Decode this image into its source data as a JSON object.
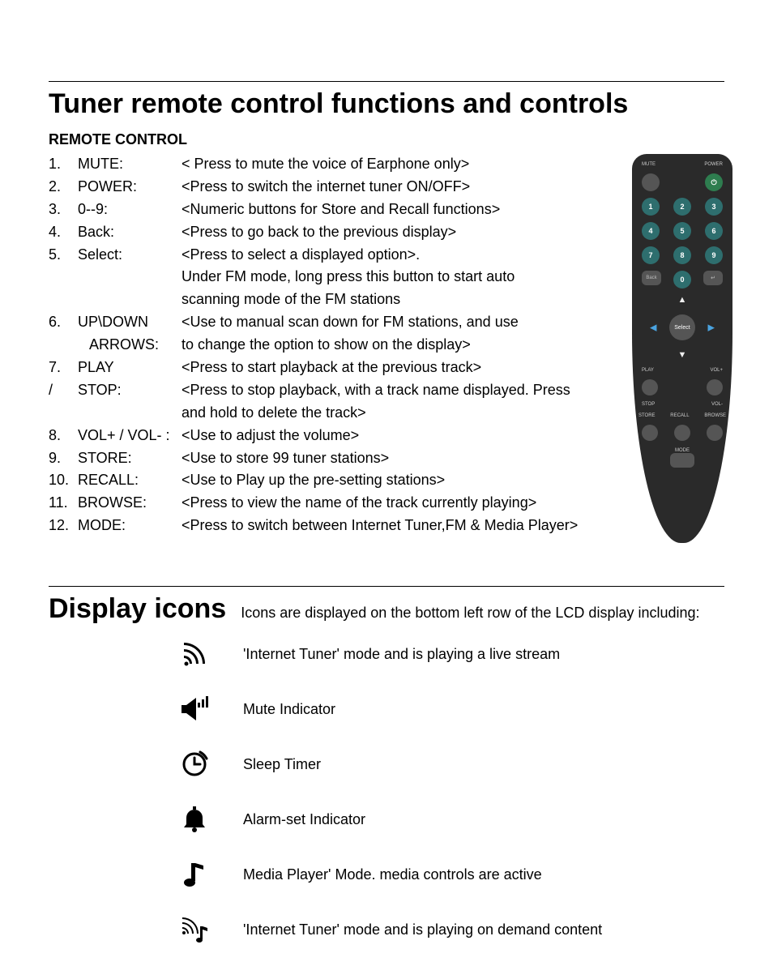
{
  "section1": {
    "title": "Tuner remote control functions and controls",
    "subhead": "REMOTE CONTROL"
  },
  "remote_list": [
    {
      "num": "1.",
      "label": "MUTE:",
      "desc": "< Press to mute the voice of Earphone only>"
    },
    {
      "num": "2.",
      "label": "POWER:",
      "desc": "<Press to switch the internet tuner ON/OFF>"
    },
    {
      "num": "3.",
      "label": "0--9:",
      "desc": "<Numeric buttons for Store and Recall functions>"
    },
    {
      "num": "4.",
      "label": "Back:",
      "desc": "<Press to go back to the previous display>"
    },
    {
      "num": "5.",
      "label": "Select:",
      "desc": "<Press to select a displayed option>.",
      "extra": [
        "Under FM mode, long press this button to start auto",
        "scanning mode of the FM stations"
      ]
    },
    {
      "num": "6.",
      "label": "UP\\DOWN",
      "desc": "<Use to manual scan down for FM stations, and use",
      "label2": "   ARROWS:",
      "desc2": "to change the option to show on the display>"
    },
    {
      "num": "7.",
      "label": "PLAY",
      "desc": "<Press to start playback at the previous track>",
      "num2": "  /",
      "label2_raw": "STOP:",
      "desc2": "<Press to stop playback, with a track name displayed. Press",
      "extra": [
        "and hold to delete the track>"
      ]
    },
    {
      "num": "8.",
      "label": "VOL+ / VOL- :",
      "desc": "<Use to adjust the volume>",
      "wide": true
    },
    {
      "num": "9.",
      "label": "STORE:",
      "desc": "<Use to store 99 tuner stations>"
    },
    {
      "num": "10.",
      "label": "RECALL:",
      "desc": "<Use to Play up the pre-setting stations>"
    },
    {
      "num": "11.",
      "label": "BROWSE:",
      "desc": "<Press to view the name of the track currently playing>"
    },
    {
      "num": "12.",
      "label": "MODE:",
      "desc": "<Press to switch between Internet Tuner,FM & Media Player>"
    }
  ],
  "remote_image": {
    "top_labels": {
      "left": "MUTE",
      "right": "POWER"
    },
    "keys": [
      "1",
      "2",
      "3",
      "4",
      "5",
      "6",
      "7",
      "8",
      "9",
      "Back",
      "0",
      "↵"
    ],
    "select_label": "Select",
    "row_labels": {
      "play": "PLAY",
      "volp": "VOL+",
      "stop": "STOP",
      "volm": "VOL-",
      "store": "STORE",
      "recall": "RECALL",
      "browse": "BROWSE",
      "mode": "MODE"
    }
  },
  "section2": {
    "title": "Display icons",
    "lead": "Icons are displayed on the bottom left row of the LCD display including:"
  },
  "icons": [
    {
      "name": "live-stream-icon",
      "desc": "'Internet Tuner' mode and is playing a live stream"
    },
    {
      "name": "mute-icon",
      "desc": "Mute Indicator"
    },
    {
      "name": "sleep-timer-icon",
      "desc": "Sleep Timer"
    },
    {
      "name": "alarm-icon",
      "desc": "Alarm-set Indicator"
    },
    {
      "name": "media-player-icon",
      "desc": "Media Player' Mode. media controls are active"
    },
    {
      "name": "on-demand-icon",
      "desc": "'Internet Tuner' mode and is playing on demand content"
    }
  ]
}
